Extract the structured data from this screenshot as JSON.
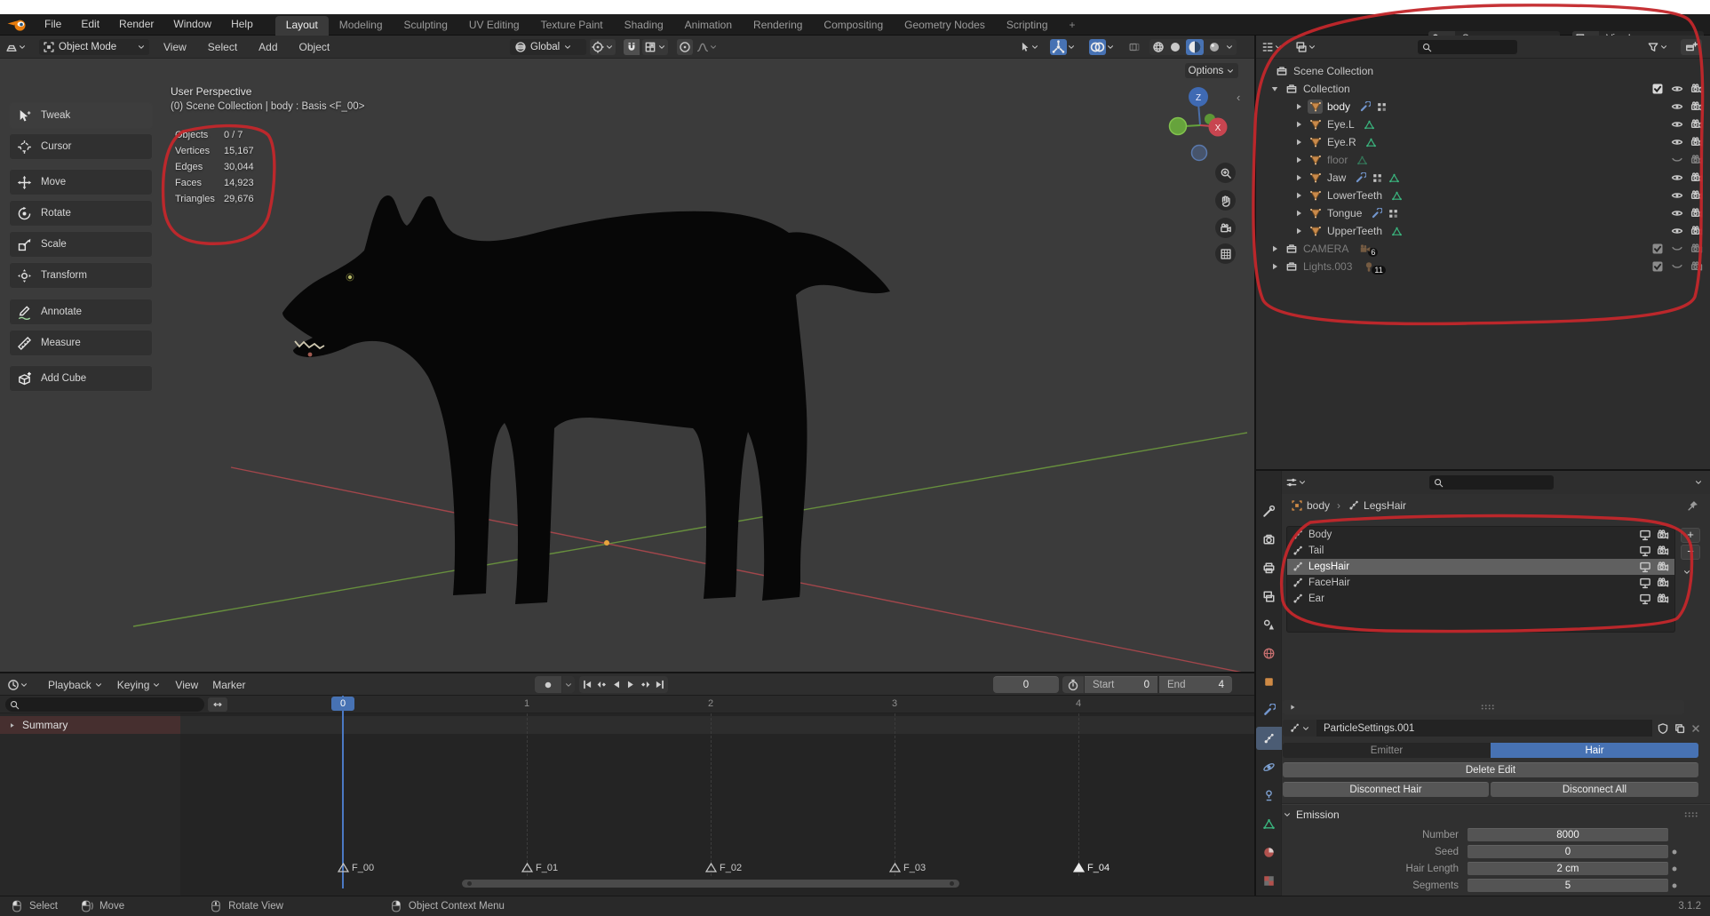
{
  "topbar": {
    "menus": [
      "File",
      "Edit",
      "Render",
      "Window",
      "Help"
    ],
    "tabs": [
      "Layout",
      "Modeling",
      "Sculpting",
      "UV Editing",
      "Texture Paint",
      "Shading",
      "Animation",
      "Rendering",
      "Compositing",
      "Geometry Nodes",
      "Scripting"
    ],
    "active_tab": "Layout",
    "new_tab_label": "+",
    "scene": "Scene",
    "viewlayer": "ViewLayer"
  },
  "viewport_header": {
    "mode": "Object Mode",
    "menus": [
      "View",
      "Select",
      "Add",
      "Object"
    ],
    "orientation": "Global",
    "options_label": "Options"
  },
  "toolbar": {
    "tools": [
      "Tweak",
      "Cursor",
      "Move",
      "Rotate",
      "Scale",
      "Transform",
      "Annotate",
      "Measure",
      "Add Cube"
    ],
    "active": "Tweak"
  },
  "viewport": {
    "view_label": "User Perspective",
    "context_label": "(0) Scene Collection | body : Basis <F_00>",
    "stats": [
      [
        "Objects",
        "0 / 7"
      ],
      [
        "Vertices",
        "15,167"
      ],
      [
        "Edges",
        "30,044"
      ],
      [
        "Faces",
        "14,923"
      ],
      [
        "Triangles",
        "29,676"
      ]
    ],
    "gizmo_axes": {
      "z": "Z",
      "x": "X"
    }
  },
  "outliner": {
    "rows": [
      {
        "label": "Scene Collection",
        "icon": "collection",
        "level": 0,
        "right": []
      },
      {
        "label": "Collection",
        "icon": "collection",
        "level": 1,
        "disclosure": "open",
        "right": [
          "checkbox",
          "eye",
          "camera"
        ]
      },
      {
        "label": "body",
        "icon": "mesh-object",
        "level": 2,
        "disclosure": "closed",
        "active": true,
        "extras": [
          "wrench",
          "nodes"
        ],
        "right": [
          "eye",
          "camera"
        ]
      },
      {
        "label": "Eye.L",
        "icon": "mesh-object",
        "level": 2,
        "disclosure": "closed",
        "extras": [
          "mesh-data"
        ],
        "right": [
          "eye",
          "camera"
        ]
      },
      {
        "label": "Eye.R",
        "icon": "mesh-object",
        "level": 2,
        "disclosure": "closed",
        "extras": [
          "mesh-data"
        ],
        "right": [
          "eye",
          "camera"
        ]
      },
      {
        "label": "floor",
        "icon": "mesh-object",
        "level": 2,
        "disclosure": "closed",
        "dim": true,
        "extras": [
          "mesh-data"
        ],
        "right": [
          "eye-closed",
          "camera"
        ]
      },
      {
        "label": "Jaw",
        "icon": "mesh-object",
        "level": 2,
        "disclosure": "closed",
        "extras": [
          "wrench",
          "nodes",
          "mesh-data"
        ],
        "right": [
          "eye",
          "camera"
        ]
      },
      {
        "label": "LowerTeeth",
        "icon": "mesh-object",
        "level": 2,
        "disclosure": "closed",
        "extras": [
          "mesh-data"
        ],
        "right": [
          "eye",
          "camera"
        ]
      },
      {
        "label": "Tongue",
        "icon": "mesh-object",
        "level": 2,
        "disclosure": "closed",
        "extras": [
          "wrench",
          "nodes"
        ],
        "right": [
          "eye",
          "camera"
        ]
      },
      {
        "label": "UpperTeeth",
        "icon": "mesh-object",
        "level": 2,
        "disclosure": "closed",
        "extras": [
          "mesh-data"
        ],
        "right": [
          "eye",
          "camera"
        ]
      },
      {
        "label": "CAMERA",
        "icon": "collection",
        "level": 1,
        "disclosure": "closed",
        "dim": true,
        "badge": "6",
        "badge_icon": "camera-data",
        "right": [
          "checkbox",
          "eye-closed",
          "camera"
        ]
      },
      {
        "label": "Lights.003",
        "icon": "collection",
        "level": 1,
        "disclosure": "closed",
        "dim": true,
        "badge": "11",
        "badge_icon": "light-data",
        "right": [
          "checkbox",
          "eye-closed",
          "camera"
        ]
      }
    ]
  },
  "properties": {
    "tabs_icons": [
      "tab-tool",
      "tab-render",
      "tab-output",
      "tab-viewlayer",
      "tab-scene",
      "tab-world",
      "tab-object",
      "tab-modifier",
      "tab-particles",
      "tab-physics",
      "tab-constraint",
      "tab-data",
      "tab-material",
      "tab-texture"
    ],
    "active_tab": "tab-particles",
    "breadcrumb": {
      "object": "body",
      "separator": "›",
      "data": "LegsHair"
    },
    "particle_systems": [
      {
        "name": "Body"
      },
      {
        "name": "Tail"
      },
      {
        "name": "LegsHair",
        "selected": true
      },
      {
        "name": "FaceHair"
      },
      {
        "name": "Ear"
      }
    ],
    "list_buttons": {
      "add": "+",
      "remove": "−"
    },
    "datablock": "ParticleSettings.001",
    "type_toggle": {
      "options": [
        "Emitter",
        "Hair"
      ],
      "active": "Hair"
    },
    "buttons": [
      "Delete Edit",
      "Disconnect Hair",
      "Disconnect All"
    ],
    "emission": {
      "title": "Emission",
      "fields": [
        {
          "label": "Number",
          "value": "8000",
          "animatable": false
        },
        {
          "label": "Seed",
          "value": "0",
          "animatable": true
        },
        {
          "label": "Hair Length",
          "value": "2 cm",
          "animatable": true
        },
        {
          "label": "Segments",
          "value": "5",
          "animatable": true
        }
      ]
    }
  },
  "timeline": {
    "menus": [
      {
        "label": "Playback",
        "dropdown": true
      },
      {
        "label": "Keying",
        "dropdown": true
      },
      {
        "label": "View",
        "dropdown": false
      },
      {
        "label": "Marker",
        "dropdown": false
      }
    ],
    "current_frame": "0",
    "start_label": "Start",
    "start_value": "0",
    "end_label": "End",
    "end_value": "4",
    "summary_label": "Summary",
    "ruler_ticks": [
      "1",
      "2",
      "3",
      "4"
    ],
    "markers": [
      {
        "label": "F_00",
        "frame": 0,
        "selected": false
      },
      {
        "label": "F_01",
        "frame": 1,
        "selected": false
      },
      {
        "label": "F_02",
        "frame": 2,
        "selected": false
      },
      {
        "label": "F_03",
        "frame": 3,
        "selected": false
      },
      {
        "label": "F_04",
        "frame": 4,
        "selected": true
      }
    ]
  },
  "statusbar": {
    "hints": [
      {
        "icon": "mouse-left",
        "label": "Select"
      },
      {
        "icon": "mouse-left-drag",
        "label": "Move"
      },
      {
        "icon": "mouse-middle",
        "label": "Rotate View"
      },
      {
        "icon": "mouse-right",
        "label": "Object Context Menu"
      }
    ],
    "version": "3.1.2"
  },
  "colors": {
    "accent": "#4772b3",
    "annotation": "#c3272b",
    "axis_x": "#b4484e",
    "axis_y": "#6f9e3e",
    "origin": "#e8a33d"
  }
}
